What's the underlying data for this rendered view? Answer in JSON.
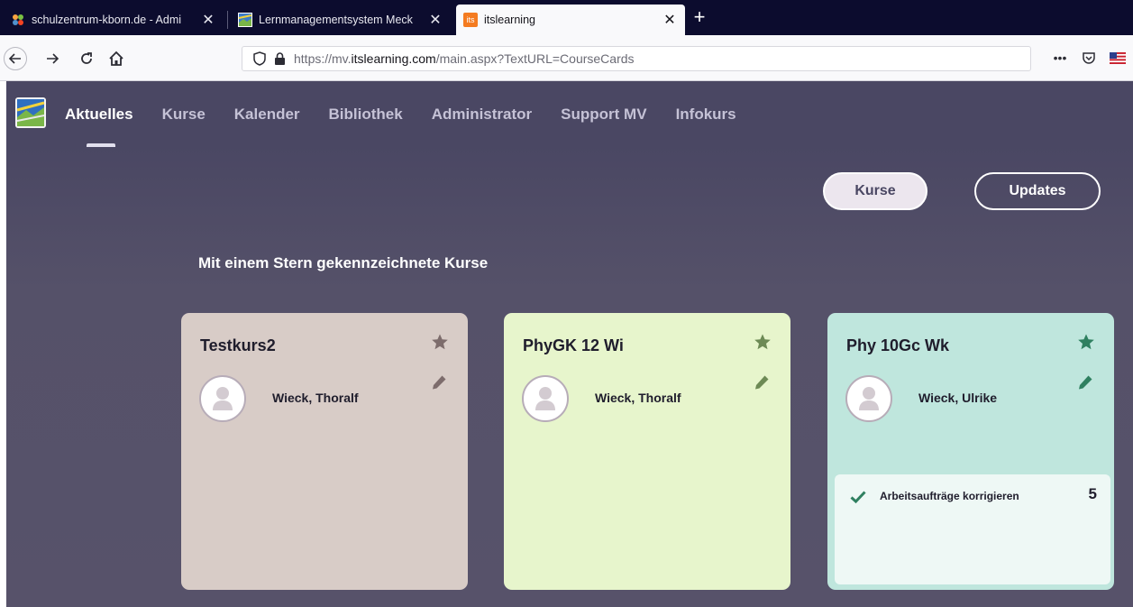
{
  "browser": {
    "tabs": [
      {
        "title": "schulzentrum-kborn.de - Admi",
        "active": false,
        "icon": "joomla-icon"
      },
      {
        "title": "Lernmanagementsystem Meck",
        "active": false,
        "icon": "lms-icon"
      },
      {
        "title": "itslearning",
        "active": true,
        "icon": "itslearning-icon",
        "icon_text": "its"
      }
    ],
    "url": {
      "prefix": "https://mv.",
      "domain": "itslearning.com",
      "path": "/main.aspx?TextURL=CourseCards"
    },
    "toolbar_right": {
      "more": "•••"
    }
  },
  "header": {
    "nav": [
      {
        "label": "Aktuelles",
        "active": true
      },
      {
        "label": "Kurse",
        "active": false
      },
      {
        "label": "Kalender",
        "active": false
      },
      {
        "label": "Bibliothek",
        "active": false
      },
      {
        "label": "Administrator",
        "active": false
      },
      {
        "label": "Support MV",
        "active": false
      },
      {
        "label": "Infokurs",
        "active": false
      }
    ]
  },
  "filters": {
    "kurse_label": "Kurse",
    "updates_label": "Updates",
    "selected": "Kurse"
  },
  "section": {
    "title": "Mit einem Stern gekennzeichnete Kurse"
  },
  "cards": [
    {
      "title": "Testkurs2",
      "owner": "Wieck, Thoralf",
      "color": "#d8ccc7",
      "icon_color": "#7d6c6c",
      "task": null
    },
    {
      "title": "PhyGK 12 Wi",
      "owner": "Wieck, Thoralf",
      "color": "#e7f5cc",
      "icon_color": "#6d8a55",
      "task": null
    },
    {
      "title": "Phy 10Gc Wk",
      "owner": "Wieck, Ulrike",
      "color": "#bfe6dd",
      "icon_color": "#2f8060",
      "task": {
        "label": "Arbeitsaufträge korrigieren",
        "count": "5"
      }
    }
  ],
  "colors": {
    "header_bg": "#4a4763",
    "page_bg": "#57526a",
    "check_green": "#2f8060"
  }
}
